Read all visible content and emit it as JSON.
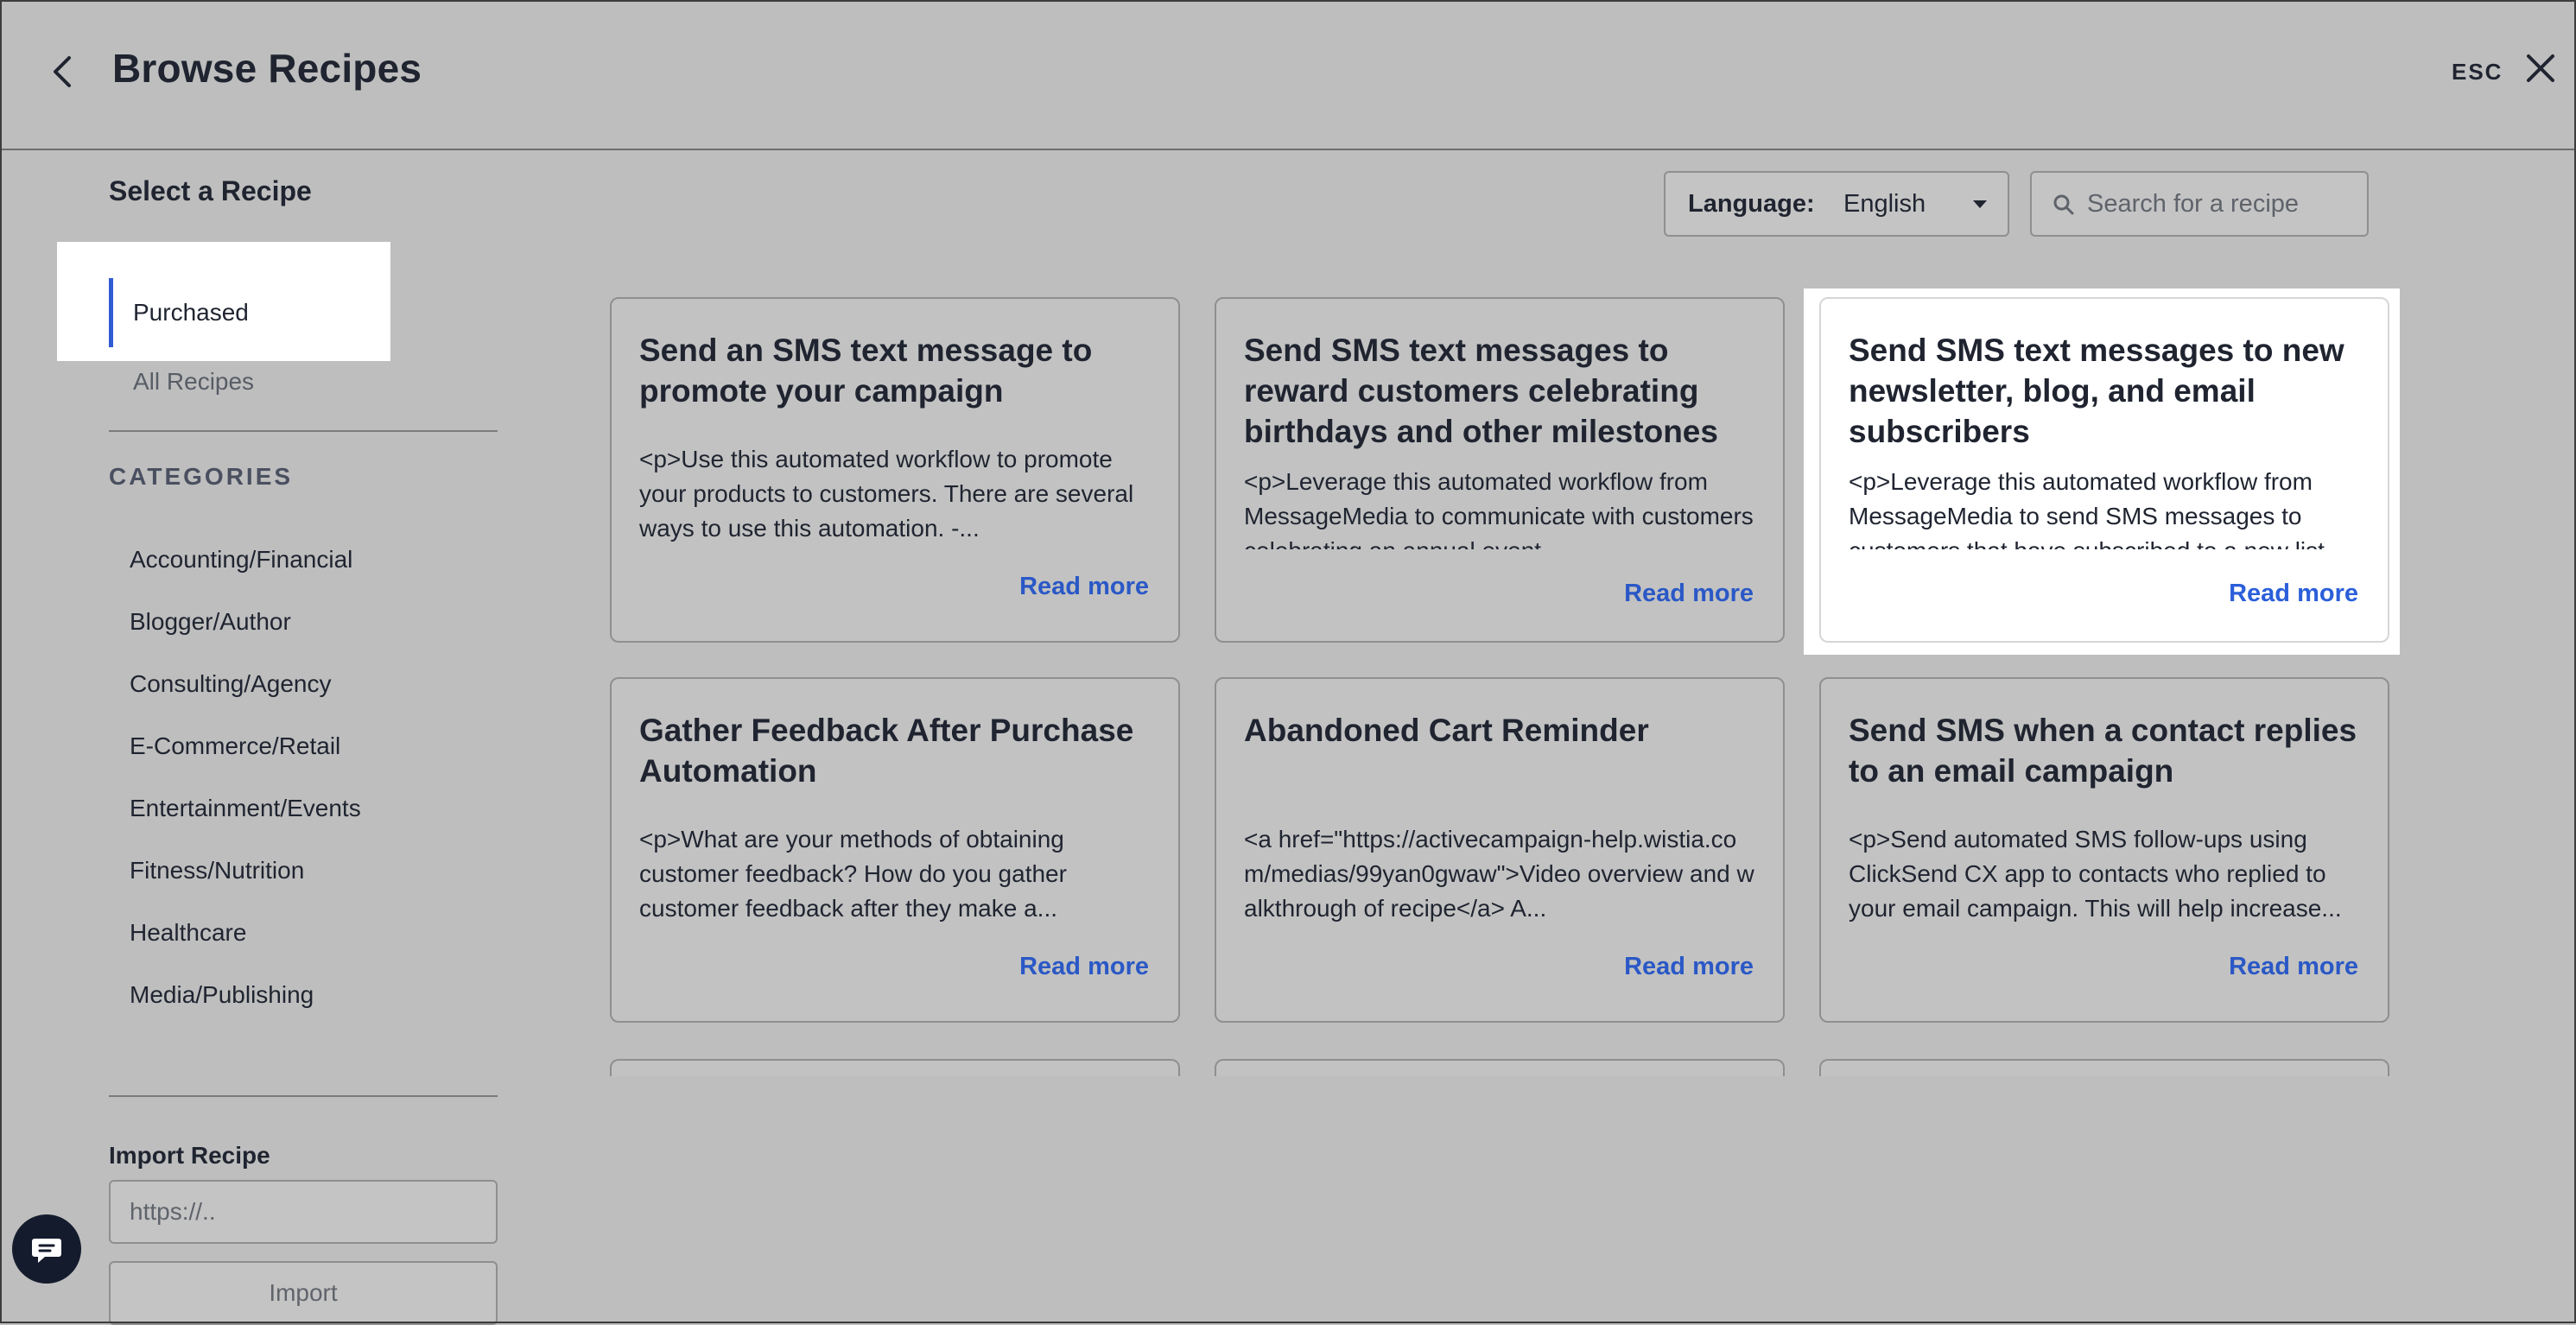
{
  "header": {
    "title": "Browse Recipes",
    "esc_label": "ESC"
  },
  "sidebar": {
    "heading": "Select a Recipe",
    "nav": [
      {
        "label": "Purchased",
        "active": true
      },
      {
        "label": "All Recipes",
        "active": false
      }
    ],
    "categories_heading": "CATEGORIES",
    "categories": [
      "Accounting/Financial",
      "Blogger/Author",
      "Consulting/Agency",
      "E-Commerce/Retail",
      "Entertainment/Events",
      "Fitness/Nutrition",
      "Healthcare",
      "Media/Publishing"
    ],
    "import": {
      "label": "Import Recipe",
      "placeholder": "https://..",
      "button_label": "Import"
    }
  },
  "filters": {
    "language_label": "Language:",
    "language_value": "English",
    "search_placeholder": "Search for a recipe"
  },
  "recipes": [
    {
      "title": "Send an SMS text message to promote your campaign",
      "description": "<p>Use this automated workflow to promote your products to customers. There are several ways to use this automation. -...",
      "read_more": "Read more"
    },
    {
      "title": "Send SMS text messages to reward customers celebrating birthdays and other milestones",
      "description": "<p>Leverage this automated workflow from MessageMedia to communicate with customers celebrating an annual event",
      "read_more": "Read more"
    },
    {
      "title": "Send SMS text messages to new newsletter, blog, and email subscribers",
      "description": "<p>Leverage this automated workflow from MessageMedia to send SMS messages to customers that have subscribed to a new list",
      "read_more": "Read more"
    },
    {
      "title": "Gather Feedback After Purchase Automation",
      "description": "<p>What are your methods of obtaining customer feedback? How do you gather customer feedback after they make a...",
      "read_more": "Read more"
    },
    {
      "title": "Abandoned Cart Reminder",
      "description": "<a href=\"https://activecampaign-help.wistia.com/medias/99yan0gwaw\">Video overview and walkthrough of recipe</a> A...",
      "read_more": "Read more"
    },
    {
      "title": "Send SMS when a contact replies to an email campaign",
      "description": "<p>Send automated SMS follow-ups using ClickSend CX app to contacts who replied to your email campaign. This will help increase...",
      "read_more": "Read more"
    }
  ],
  "icons": {
    "back": "chevron-left-icon",
    "close": "close-icon",
    "search": "search-icon",
    "dropdown": "caret-down-icon",
    "chat": "chat-icon"
  },
  "colors": {
    "overlay_background": "#bebebe",
    "highlight": "#ffffff",
    "link": "#2a58c6",
    "active_indicator": "#2f5bd3",
    "chat_button": "#141b2c"
  }
}
